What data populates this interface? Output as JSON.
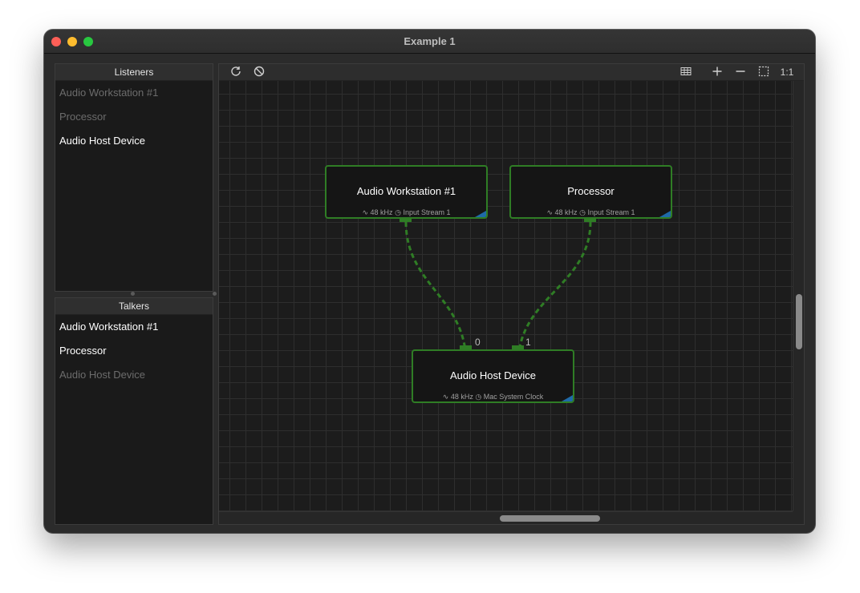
{
  "window": {
    "title": "Example 1"
  },
  "listeners": {
    "header": "Listeners",
    "items": [
      {
        "label": "Audio Workstation #1",
        "dim": true
      },
      {
        "label": "Processor",
        "dim": true
      },
      {
        "label": "Audio Host Device",
        "dim": false
      }
    ]
  },
  "talkers": {
    "header": "Talkers",
    "items": [
      {
        "label": "Audio Workstation #1",
        "dim": false
      },
      {
        "label": "Processor",
        "dim": false
      },
      {
        "label": "Audio Host Device",
        "dim": true
      }
    ]
  },
  "toolbar": {
    "left_icons": [
      "refresh-icon",
      "cancel-icon"
    ],
    "right_icons": [
      "grid-icon",
      "zoom-in-icon",
      "zoom-out-icon",
      "fit-selection-icon"
    ],
    "zoom_reset_label": "1:1"
  },
  "nodes": [
    {
      "id": "aw1",
      "title": "Audio Workstation #1",
      "sample_rate": "48 kHz",
      "clock": "Input Stream 1"
    },
    {
      "id": "proc",
      "title": "Processor",
      "sample_rate": "48 kHz",
      "clock": "Input Stream 1"
    },
    {
      "id": "host",
      "title": "Audio Host Device",
      "sample_rate": "48 kHz",
      "clock": "Mac System Clock"
    }
  ],
  "ports": {
    "host_input_0": "0",
    "host_input_1": "1"
  },
  "colors": {
    "node_border": "#2f7d25",
    "connection": "#2f7d25",
    "node_badge": "#1f6aa8"
  }
}
